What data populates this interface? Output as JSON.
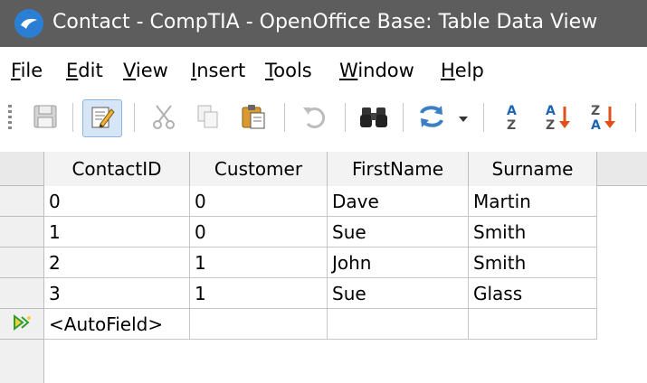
{
  "window": {
    "title": "Contact - CompTIA - OpenOffice Base: Table Data View"
  },
  "menu": {
    "items": [
      {
        "first": "F",
        "rest": "ile"
      },
      {
        "first": "E",
        "rest": "dit"
      },
      {
        "first": "V",
        "rest": "iew"
      },
      {
        "first": "I",
        "rest": "nsert"
      },
      {
        "first": "T",
        "rest": "ools"
      },
      {
        "first": "W",
        "rest": "indow"
      },
      {
        "first": "H",
        "rest": "elp"
      }
    ]
  },
  "toolbar": {
    "icons": [
      "save-icon",
      "edit-data-icon",
      "cut-icon",
      "copy-icon",
      "paste-icon",
      "undo-icon",
      "find-icon",
      "refresh-icon",
      "sort-icon",
      "sort-ascending-icon",
      "sort-descending-icon"
    ]
  },
  "table": {
    "columns": [
      "ContactID",
      "Customer",
      "FirstName",
      "Surname"
    ],
    "rows": [
      [
        "0",
        "0",
        "Dave",
        "Martin"
      ],
      [
        "1",
        "0",
        "Sue",
        "Smith"
      ],
      [
        "2",
        "1",
        "John",
        "Smith"
      ],
      [
        "3",
        "1",
        "Sue",
        "Glass"
      ]
    ],
    "new_row": [
      "<AutoField>",
      "",
      "",
      ""
    ]
  },
  "colors": {
    "titlebar": "#5d5d5d",
    "app_icon": "#2a7fd4",
    "row_marker": "#2e9e2e",
    "sort_arrow": "#e0501a",
    "sort_letters": "#1f64b4"
  }
}
